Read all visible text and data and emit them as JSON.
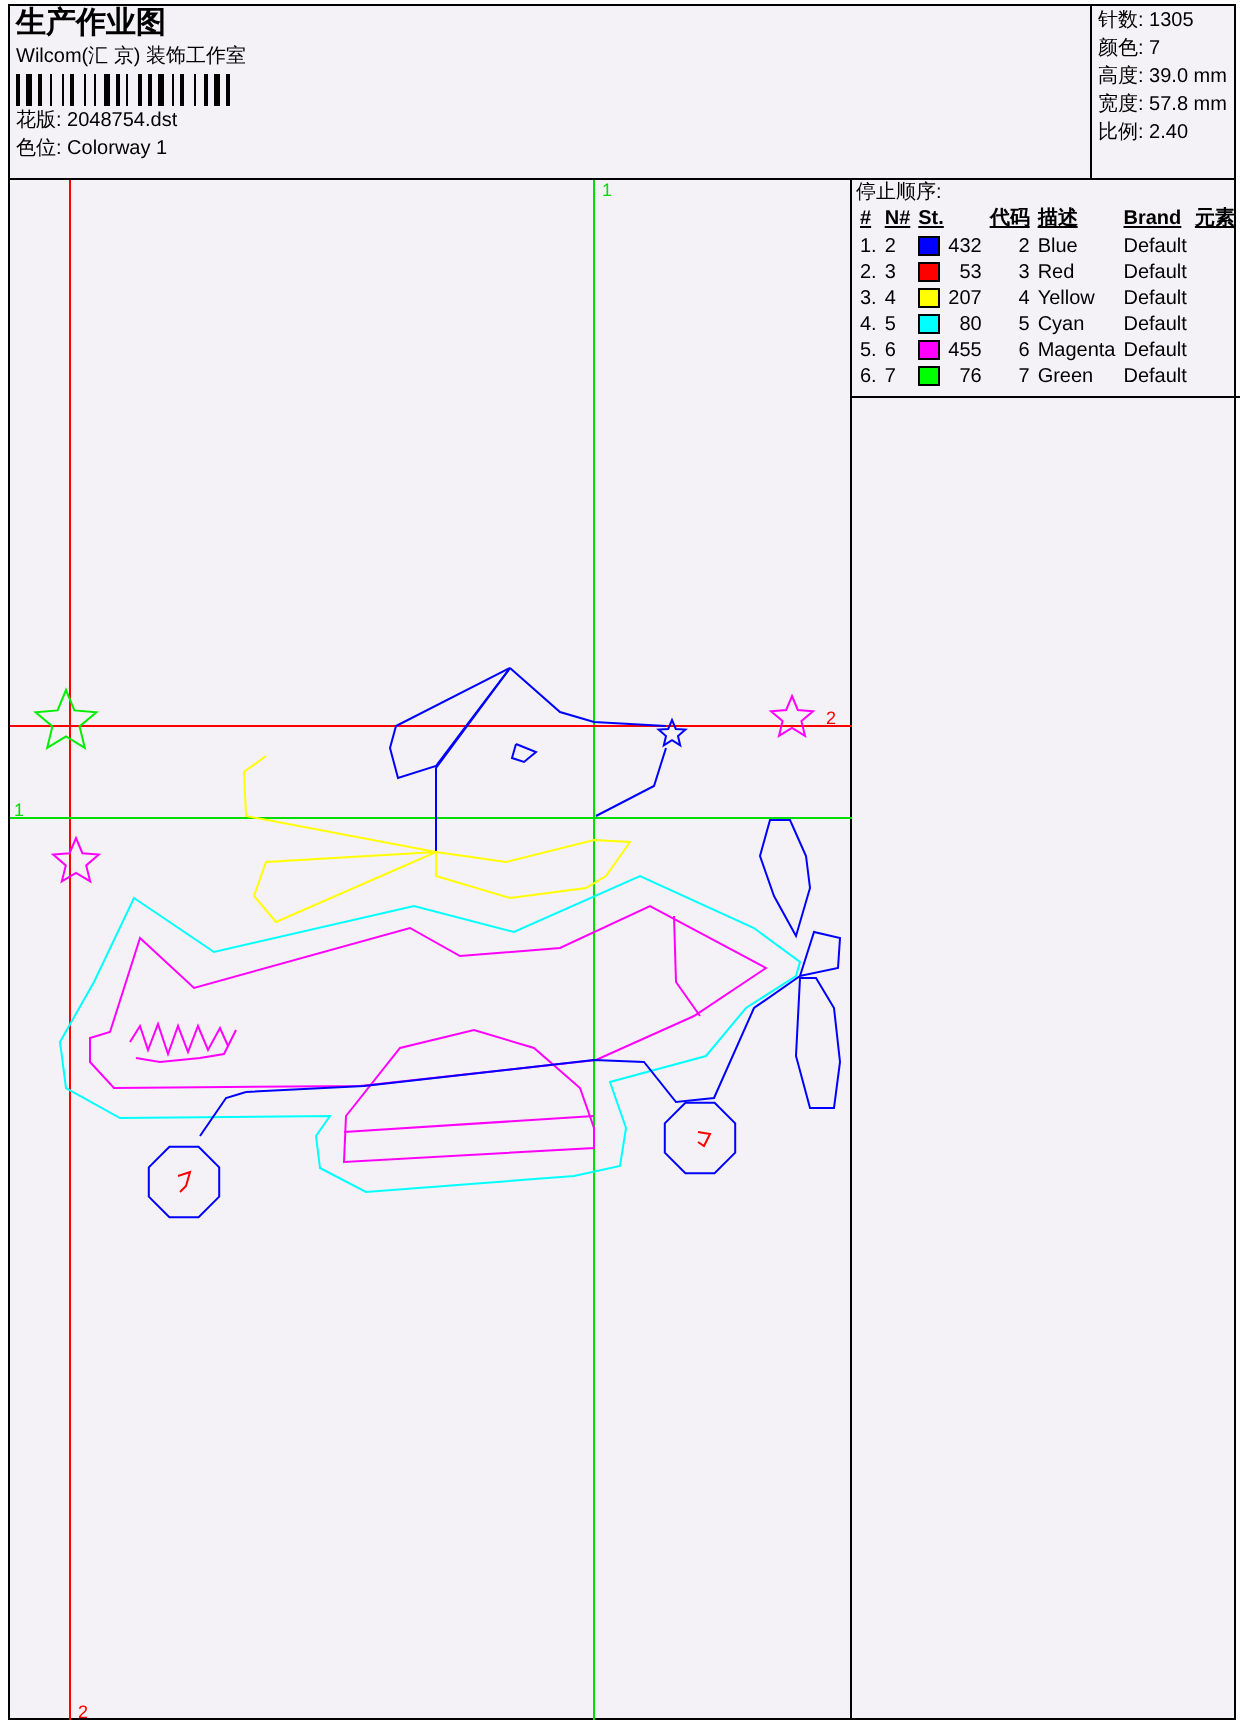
{
  "header": {
    "title": "生产作业图",
    "company": "Wilcom(汇 京) 装饰工作室",
    "design": "花版: 2048754.dst",
    "colorway": "色位: Colorway 1"
  },
  "summary": [
    "针数: 1305",
    "颜色: 7",
    "高度: 39.0 mm",
    "宽度: 57.8 mm",
    "比例: 2.40"
  ],
  "guides": [
    {
      "label": "1",
      "kind": "vertical",
      "color": "#00dd00"
    },
    {
      "label": "2",
      "kind": "vertical",
      "color": "#ff0000"
    },
    {
      "label": "1",
      "kind": "horizontal",
      "color": "#00dd00"
    },
    {
      "label": "2",
      "kind": "horizontal",
      "color": "#ff0000"
    }
  ],
  "stop_sequence": {
    "title": "停止顺序:",
    "columns": [
      "#",
      "N#",
      "St.",
      "代码",
      "描述",
      "Brand",
      "元素"
    ],
    "rows": [
      {
        "index": "1.",
        "needle": "2",
        "color": "#0000ff",
        "stitches": "432",
        "code": "2",
        "description": "Blue",
        "brand": "Default"
      },
      {
        "index": "2.",
        "needle": "3",
        "color": "#ff0000",
        "stitches": "53",
        "code": "3",
        "description": "Red",
        "brand": "Default"
      },
      {
        "index": "3.",
        "needle": "4",
        "color": "#ffff00",
        "stitches": "207",
        "code": "4",
        "description": "Yellow",
        "brand": "Default"
      },
      {
        "index": "4.",
        "needle": "5",
        "color": "#00ffff",
        "stitches": "80",
        "code": "5",
        "description": "Cyan",
        "brand": "Default"
      },
      {
        "index": "5.",
        "needle": "6",
        "color": "#ff00ff",
        "stitches": "455",
        "code": "6",
        "description": "Magenta",
        "brand": "Default"
      },
      {
        "index": "6.",
        "needle": "7",
        "color": "#00ff00",
        "stitches": "76",
        "code": "7",
        "description": "Green",
        "brand": "Default"
      }
    ]
  }
}
